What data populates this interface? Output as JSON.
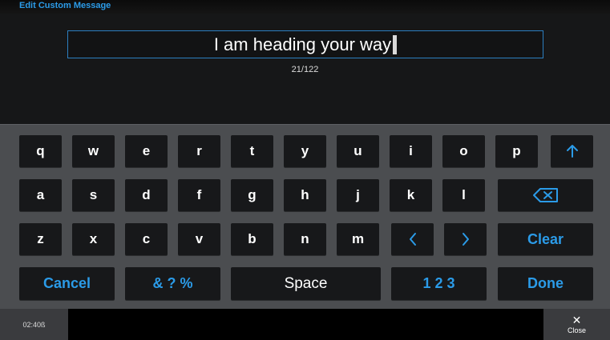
{
  "window": {
    "title": "Edit Custom Message"
  },
  "editor": {
    "value": "I am heading your way",
    "counter": "21/122"
  },
  "keyboard": {
    "row1": [
      "q",
      "w",
      "e",
      "r",
      "t",
      "y",
      "u",
      "i",
      "o",
      "p"
    ],
    "row2": [
      "a",
      "s",
      "d",
      "f",
      "g",
      "h",
      "j",
      "k",
      "l"
    ],
    "row3": [
      "z",
      "x",
      "c",
      "v",
      "b",
      "n",
      "m"
    ],
    "clear_label": "Clear",
    "cancel_label": "Cancel",
    "symbols_label": "& ? %",
    "space_label": "Space",
    "numbers_label": "1 2 3",
    "done_label": "Done",
    "shift_icon": "arrow-up-icon",
    "backspace_icon": "backspace-icon",
    "left_icon": "chevron-left-icon",
    "right_icon": "chevron-right-icon"
  },
  "statusbar": {
    "time": "02:40ß",
    "close_label": "Close",
    "close_icon": "close-icon"
  },
  "colors": {
    "accent": "#2b9be8",
    "key_bg": "#17181a",
    "keyboard_bg": "#4b4d50",
    "text": "#ffffff"
  }
}
